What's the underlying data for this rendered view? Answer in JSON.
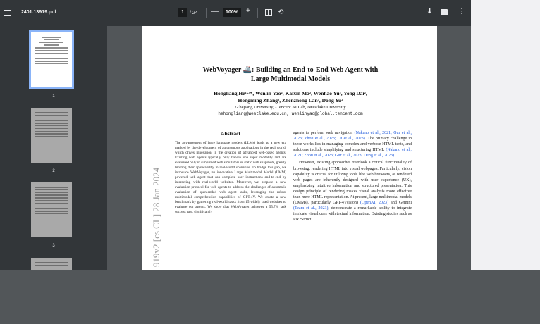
{
  "toolbar": {
    "filename": "2401.13919.pdf",
    "current_page": "1",
    "total_pages": "/ 24",
    "zoom": "100%",
    "zoom_minus": "—",
    "zoom_plus": "+"
  },
  "sidebar": {
    "thumbnails": [
      {
        "number": "1",
        "active": true
      },
      {
        "number": "2",
        "active": false
      },
      {
        "number": "3",
        "active": false
      }
    ]
  },
  "document": {
    "title_line1": "WebVoyager 🚢: Building an End-to-End Web Agent with",
    "title_line2": "Large Multimodal Models",
    "authors_line1": "Hongliang He¹·³*, Wenlin Yao², Kaixin Ma², Wenhao Yu², Yong Dai²,",
    "authors_line2": "Hongming Zhang², Zhenzhong Lan³, Dong Yu²",
    "affiliations": "¹Zhejiang University, ²Tencent AI Lab, ³Westlake University",
    "email": "hehongliang@westlake.edu.cn, wenlinyao@global.tencent.com",
    "abstract_heading": "Abstract",
    "abstract_text": "The advancement of large language models (LLMs) leads to a new era marked by the development of autonomous applications in the real world, which drives innovation in the creation of advanced web-based agents. Existing web agents typically only handle one input modality and are evaluated only in simplified web simulators or static web snapshots, greatly limiting their applicability in real-world scenarios. To bridge this gap, we introduce WebVoyager, an innovative Large Multimodal Model (LMM) powered web agent that can complete user instructions end-to-end by interacting with real-world websites. Moreover, we propose a new evaluation protocol for web agents to address the challenges of automatic evaluation of open-ended web agent tasks, leveraging the robust multimodal comprehension capabilities of GPT-4V. We create a new benchmark by gathering real-world tasks from 15 widely used websites to evaluate our agents. We show that WebVoyager achieves a 55.7% task success rate, significantly",
    "col2_p1_before": "agents to perform web navigation ",
    "col2_p1_cite1": "(Nakano et al., 2021; Gur et al., 2023; Zhou et al., 2023; Lu et al., 2023)",
    "col2_p1_after": ". The primary challenge in these works lies in managing complex and verbose HTML texts, and solutions include simplifying and structuring HTML ",
    "col2_p1_cite2": "(Nakano et al., 2021; Zhou et al., 2023; Gur et al., 2023; Deng et al., 2023)",
    "col2_p1_end": ".",
    "col2_p2_before": "However, existing approaches overlook a critical functionality of browsing: rendering HTML into visual webpages. Particularly, vision capability is crucial for utilizing tools like web browsers, as rendered web pages are inherently designed with user experience (UX), emphasizing intuitive information and structured presentation. This design principle of rendering makes visual analysis more effective than mere HTML representation. At present, large multimodal models (LMMs), particularly GPT-4V(ision) ",
    "col2_p2_cite1": "(OpenAI, 2023)",
    "col2_p2_mid": " and Gemini ",
    "col2_p2_cite2": "(Team et al., 2023)",
    "col2_p2_after": ", demonstrate a remarkable ability to integrate intricate visual cues with textual information. Existing studies such as Pix2Struct",
    "arxiv_stamp": "919v2  [cs.CL]  28 Jan 2024"
  }
}
